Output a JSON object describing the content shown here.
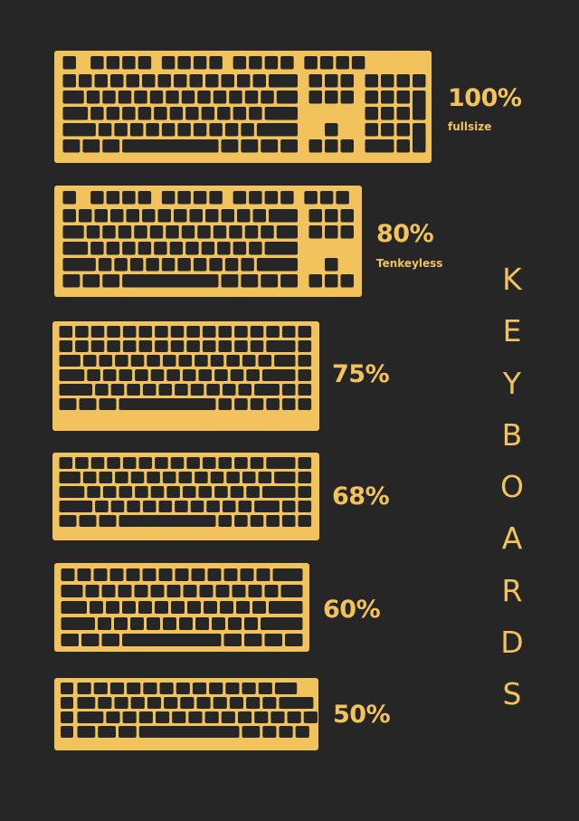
{
  "colors": {
    "background": "#262626",
    "accent": "#F2C25C",
    "key": "#262626"
  },
  "title": "KEYBOARDS",
  "keyboards": [
    {
      "id": "100",
      "label": "100%",
      "sub": "fullsize"
    },
    {
      "id": "80",
      "label": "80%",
      "sub": "Tenkeyless"
    },
    {
      "id": "75",
      "label": "75%",
      "sub": ""
    },
    {
      "id": "68",
      "label": "68%",
      "sub": ""
    },
    {
      "id": "60",
      "label": "60%",
      "sub": ""
    },
    {
      "id": "50",
      "label": "50%",
      "sub": ""
    }
  ]
}
